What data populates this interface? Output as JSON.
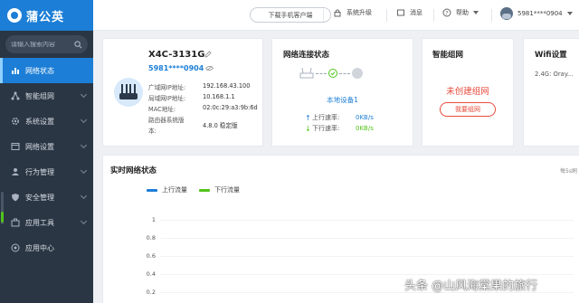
{
  "app": {
    "brand": "蒲公英"
  },
  "sidebar": {
    "search_placeholder": "请输入搜索内容",
    "items": [
      {
        "label": "网络状态",
        "active": true
      },
      {
        "label": "智能组网"
      },
      {
        "label": "系统设置"
      },
      {
        "label": "网络设置"
      },
      {
        "label": "行为管理"
      },
      {
        "label": "安全管理"
      },
      {
        "label": "应用工具"
      },
      {
        "label": "应用中心"
      }
    ]
  },
  "header": {
    "download_label": "下载手机客户端",
    "upgrade_label": "系统升级",
    "message_label": "消息",
    "help_label": "帮助",
    "user_label": "5981****0904"
  },
  "device": {
    "name": "X4C-3131G",
    "sn": "5981****0904",
    "rows": [
      {
        "label": "广域网IP地址:",
        "value": "192.168.43.100"
      },
      {
        "label": "局域网IP地址:",
        "value": "10.168.1.1"
      },
      {
        "label": "MAC地址:",
        "value": "02:0c:29:a3:9b:6d"
      },
      {
        "label": "路由器系统版",
        "value": "4.8.0 稳定版"
      }
    ],
    "row_cont": "本:"
  },
  "connection": {
    "title": "网络连接状态",
    "device_label": "本地设备1",
    "up_label": "上行速率:",
    "up_value": "0KB/s",
    "down_label": "下行速率:",
    "down_value": "0KB/s"
  },
  "mesh": {
    "title": "智能组网",
    "status": "未创建组网",
    "button": "我要组网"
  },
  "wifi": {
    "title": "Wifi设置",
    "row": "2.4G: Oray..."
  },
  "realtime": {
    "title": "实时网络状态",
    "right_text": "每5s刷",
    "legend_up": "上行流量",
    "legend_down": "下行流量",
    "y_labels": [
      "1",
      "0.8",
      "0.6",
      "0.4",
      "0.2"
    ]
  },
  "colors": {
    "accent": "#1c7ed6",
    "up": "#1c7ed6",
    "down": "#52c41a",
    "danger": "#e74c3c"
  },
  "watermark": "头条 @山风海棠果的旅行"
}
